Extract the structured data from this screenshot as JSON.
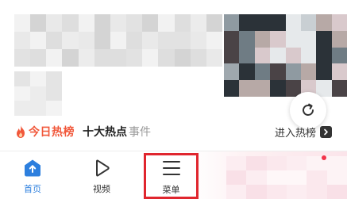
{
  "colors": {
    "accent_blue": "#2d7fde",
    "hot_orange": "#f1583b",
    "highlight_red": "#e0262e",
    "notification_red": "#f3334a"
  },
  "feed": {
    "refresh_icon": "refresh-icon",
    "hot_list": {
      "brand": "今日热榜",
      "title": "十大热点",
      "title_fade": "事件",
      "enter_label": "进入热榜",
      "flame_icon": "flame-icon",
      "arrow_icon": "chevron-right-icon"
    }
  },
  "tab_bar": {
    "tabs": [
      {
        "label": "首页",
        "icon": "home-upload-icon",
        "active": true
      },
      {
        "label": "视频",
        "icon": "play-icon",
        "active": false
      },
      {
        "label": "菜单",
        "icon": "menu-icon",
        "active": false
      }
    ]
  }
}
